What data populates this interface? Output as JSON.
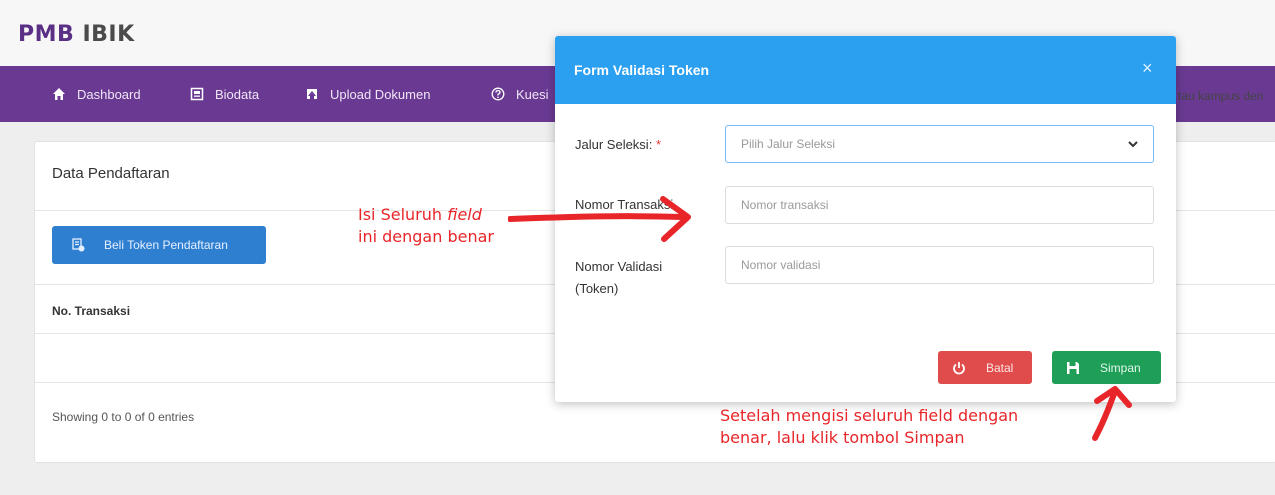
{
  "app": {
    "logo_prefix": "PMB",
    "logo_suffix": "IBIK"
  },
  "nav": {
    "items": [
      {
        "label": "Dashboard",
        "icon": "home-icon"
      },
      {
        "label": "Biodata",
        "icon": "id-card-icon"
      },
      {
        "label": "Upload Dokumen",
        "icon": "upload-icon"
      },
      {
        "label": "Kuesi",
        "icon": "question-icon"
      }
    ]
  },
  "main": {
    "card_title": "Data Pendaftaran",
    "beli_button": "Beli Token Pendaftaran",
    "table_header": "No. Transaksi",
    "right_text": "tau kampus den",
    "showing": "Showing 0 to 0 of 0 entries"
  },
  "modal": {
    "title": "Form Validasi Token",
    "close": "×",
    "jalur": {
      "label": "Jalur Seleksi:",
      "required": "*",
      "placeholder": "Pilih Jalur Seleksi"
    },
    "nomor_transaksi": {
      "label": "Nomor Transaksi",
      "placeholder": "Nomor transaksi"
    },
    "nomor_validasi": {
      "label_line1": "Nomor Validasi",
      "label_line2": "(Token)",
      "placeholder": "Nomor validasi"
    },
    "batal": "Batal",
    "simpan": "Simpan"
  },
  "annotations": {
    "left_pre": "Isi Seluruh ",
    "left_em": "field",
    "left_line2": "ini dengan benar",
    "bottom_line1": "Setelah mengisi  seluruh field dengan",
    "bottom_line2": "benar, lalu klik tombol Simpan"
  },
  "colors": {
    "nav_bg": "#6a3a93",
    "modal_header": "#2b9ff0",
    "batal": "#e04b4b",
    "simpan": "#1e9e56",
    "annotation": "#e8262a"
  }
}
